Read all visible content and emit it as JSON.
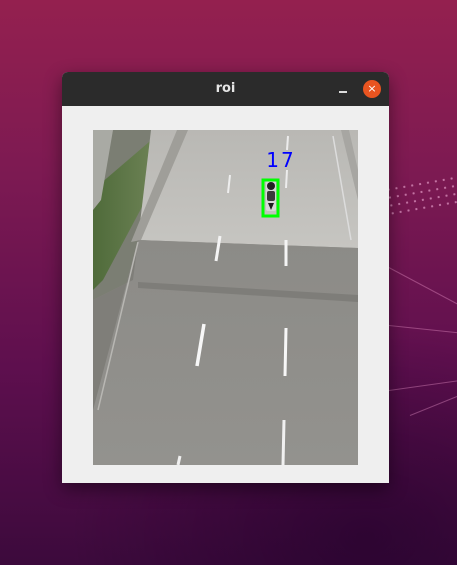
{
  "window": {
    "title": "roi",
    "close_symbol": "×"
  },
  "detection": {
    "track_id": "17",
    "label_color": "#0000ff",
    "box_color": "#00ff00"
  },
  "icons": {
    "minimize": "minimize-icon",
    "close": "close-icon"
  },
  "colors": {
    "titlebar": "#2b2b2b",
    "close_button": "#e95420",
    "window_body": "#efefef"
  }
}
